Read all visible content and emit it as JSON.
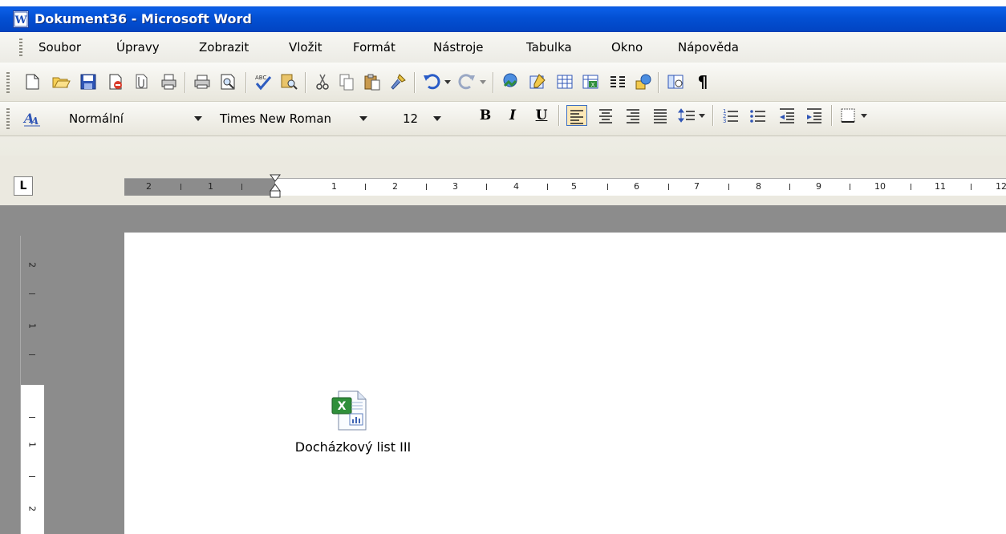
{
  "window": {
    "title": "Dokument36 - Microsoft Word"
  },
  "menu": {
    "items": [
      {
        "label": "Soubor"
      },
      {
        "label": "Úpravy"
      },
      {
        "label": "Zobrazit"
      },
      {
        "label": "Vložit"
      },
      {
        "label": "Formát"
      },
      {
        "label": "Nástroje"
      },
      {
        "label": "Tabulka"
      },
      {
        "label": "Okno"
      },
      {
        "label": "Nápověda"
      }
    ]
  },
  "formatting": {
    "style": "Normální",
    "font": "Times New Roman",
    "size": "12",
    "bold_label": "B",
    "italic_label": "I",
    "underline_label": "U",
    "pilcrow_label": "¶"
  },
  "ruler": {
    "tab_selector_label": "L",
    "h_labels": [
      "2",
      "1",
      "1",
      "2",
      "3",
      "4",
      "5",
      "6",
      "7",
      "8",
      "9",
      "10",
      "11",
      "12"
    ],
    "v_labels": [
      "2",
      "1",
      "1",
      "2"
    ]
  },
  "document": {
    "embedded_object": {
      "caption": "Docházkový list III",
      "icon": "excel-file-icon"
    }
  },
  "colors": {
    "titlebar": "#0350d4",
    "toolbar_bg": "#ecebe2",
    "workarea_bg": "#8c8c8c",
    "active_button": "#fde8b7"
  }
}
